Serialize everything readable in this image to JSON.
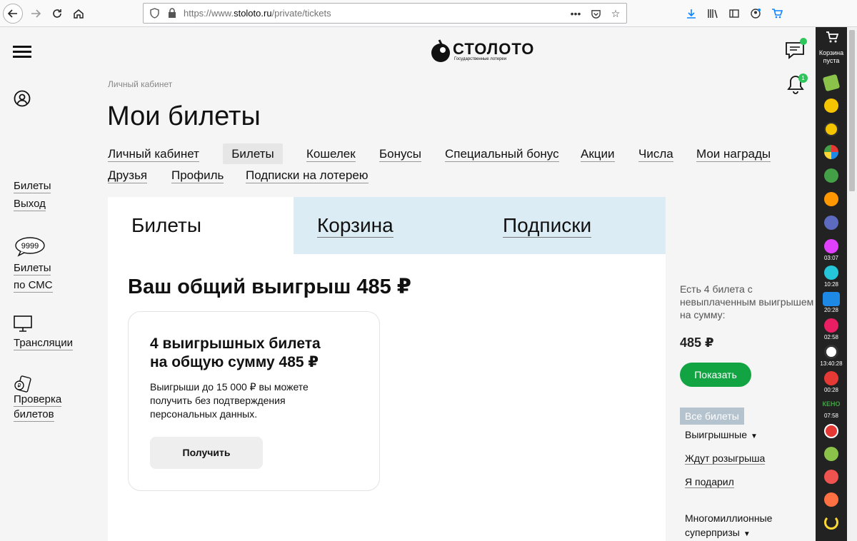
{
  "browser": {
    "url_prefix": "https://www.",
    "url_host": "stoloto.ru",
    "url_path": "/private/tickets"
  },
  "logo": {
    "name": "СТОЛОТО",
    "tagline": "Государственные лотереи"
  },
  "notifications": {
    "bell_count": "1"
  },
  "sidebar": {
    "tickets": "Билеты",
    "logout": "Выход",
    "sms_badge": "9999",
    "sms_line1": "Билеты",
    "sms_line2": "по СМС",
    "broadcasts": "Трансляции",
    "check_line1": "Проверка",
    "check_line2": "билетов"
  },
  "breadcrumb": "Личный кабинет",
  "page_title": "Мои билеты",
  "menu": {
    "items": [
      "Личный кабинет",
      "Билеты",
      "Кошелек",
      "Бонусы",
      "Специальный бонус",
      "Акции",
      "Числа",
      "Мои награды",
      "Друзья",
      "Профиль",
      "Подписки на лотерею"
    ],
    "active": "Билеты"
  },
  "tabs": [
    "Билеты",
    "Корзина",
    "Подписки"
  ],
  "win": {
    "title": "Ваш общий выигрыш 485 ₽",
    "card_title_1": "4 выигрышных билета",
    "card_title_2": "на общую сумму 485 ₽",
    "card_text_1": "Выигрыши до 15 000 ₽ вы можете",
    "card_text_2": "получить без подтверждения",
    "card_text_3": "персональных данных.",
    "button": "Получить"
  },
  "right_panel": {
    "unpaid_1": "Есть 4 билета с",
    "unpaid_2": "невыплаченным выигрышем",
    "unpaid_3": "на сумму:",
    "sum": "485 ₽",
    "show_button": "Показать",
    "filters": {
      "all": "Все билеты",
      "winning": "Выигрышные",
      "waiting": "Ждут розыгрыша",
      "gifted": "Я подарил",
      "super_1": "Многомиллионные",
      "super_2": "суперпризы"
    }
  },
  "lottery_strip": {
    "cart_1": "Корзина",
    "cart_2": "пуста",
    "times": [
      "03:07",
      "10:28",
      "20:28",
      "02:58",
      "13:40:28",
      "00:28",
      "07:58"
    ],
    "keno_label": "КЕНО",
    "colors": {
      "accent_green": "#12a442",
      "tab_blue": "#dcecf4",
      "strip_dark": "#222222"
    }
  }
}
